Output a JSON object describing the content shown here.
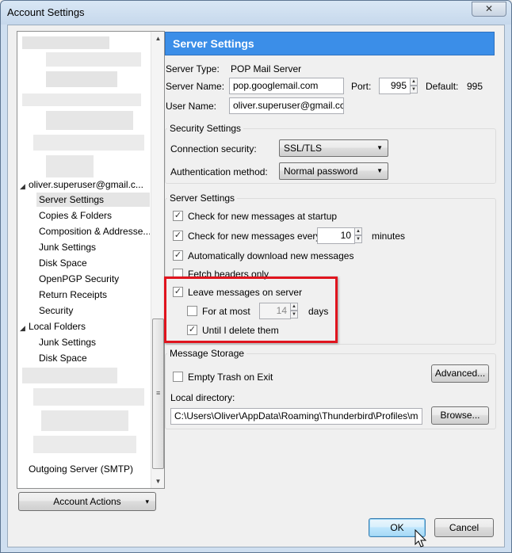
{
  "window": {
    "title": "Account Settings",
    "close_glyph": "✕"
  },
  "tree": {
    "account": "oliver.superuser@gmail.c...",
    "items": [
      "Server Settings",
      "Copies & Folders",
      "Composition & Addresse...",
      "Junk Settings",
      "Disk Space",
      "OpenPGP Security",
      "Return Receipts",
      "Security"
    ],
    "local_folders": "Local Folders",
    "local_items": [
      "Junk Settings",
      "Disk Space"
    ],
    "outgoing": "Outgoing Server (SMTP)",
    "scroll_up": "▲",
    "scroll_down": "▼",
    "grip": "≡",
    "twisty": "◢"
  },
  "account_actions": {
    "label": "Account Actions",
    "arrow": "▾"
  },
  "server": {
    "header": "Server Settings",
    "server_type_label": "Server Type:",
    "server_type": "POP Mail Server",
    "server_name_label": "Server Name:",
    "server_name": "pop.googlemail.com",
    "port_label": "Port:",
    "port": "995",
    "default_label": "Default:",
    "default_value": "995",
    "user_name_label": "User Name:",
    "user_name": "oliver.superuser@gmail.cc"
  },
  "security": {
    "group_title": "Security Settings",
    "connection_label": "Connection security:",
    "connection_value": "SSL/TLS",
    "auth_label": "Authentication method:",
    "auth_value": "Normal password"
  },
  "server_settings": {
    "group_title": "Server Settings",
    "check_startup": "Check for new messages at startup",
    "check_every": "Check for new messages every",
    "check_minutes_value": "10",
    "minutes_label": "minutes",
    "auto_download": "Automatically download new messages",
    "fetch_headers": "Fetch headers only",
    "leave_on_server": "Leave messages on server",
    "for_at_most": "For at most",
    "days_value": "14",
    "days_label": "days",
    "until_delete": "Until I delete them"
  },
  "storage": {
    "group_title": "Message Storage",
    "empty_trash": "Empty Trash on Exit",
    "advanced": "Advanced...",
    "local_dir_label": "Local directory:",
    "local_dir": "C:\\Users\\Oliver\\AppData\\Roaming\\Thunderbird\\Profiles\\m",
    "browse": "Browse..."
  },
  "footer": {
    "ok": "OK",
    "cancel": "Cancel"
  },
  "colors": {
    "header_bg": "#3b8ee8",
    "highlight": "#e0141e"
  }
}
